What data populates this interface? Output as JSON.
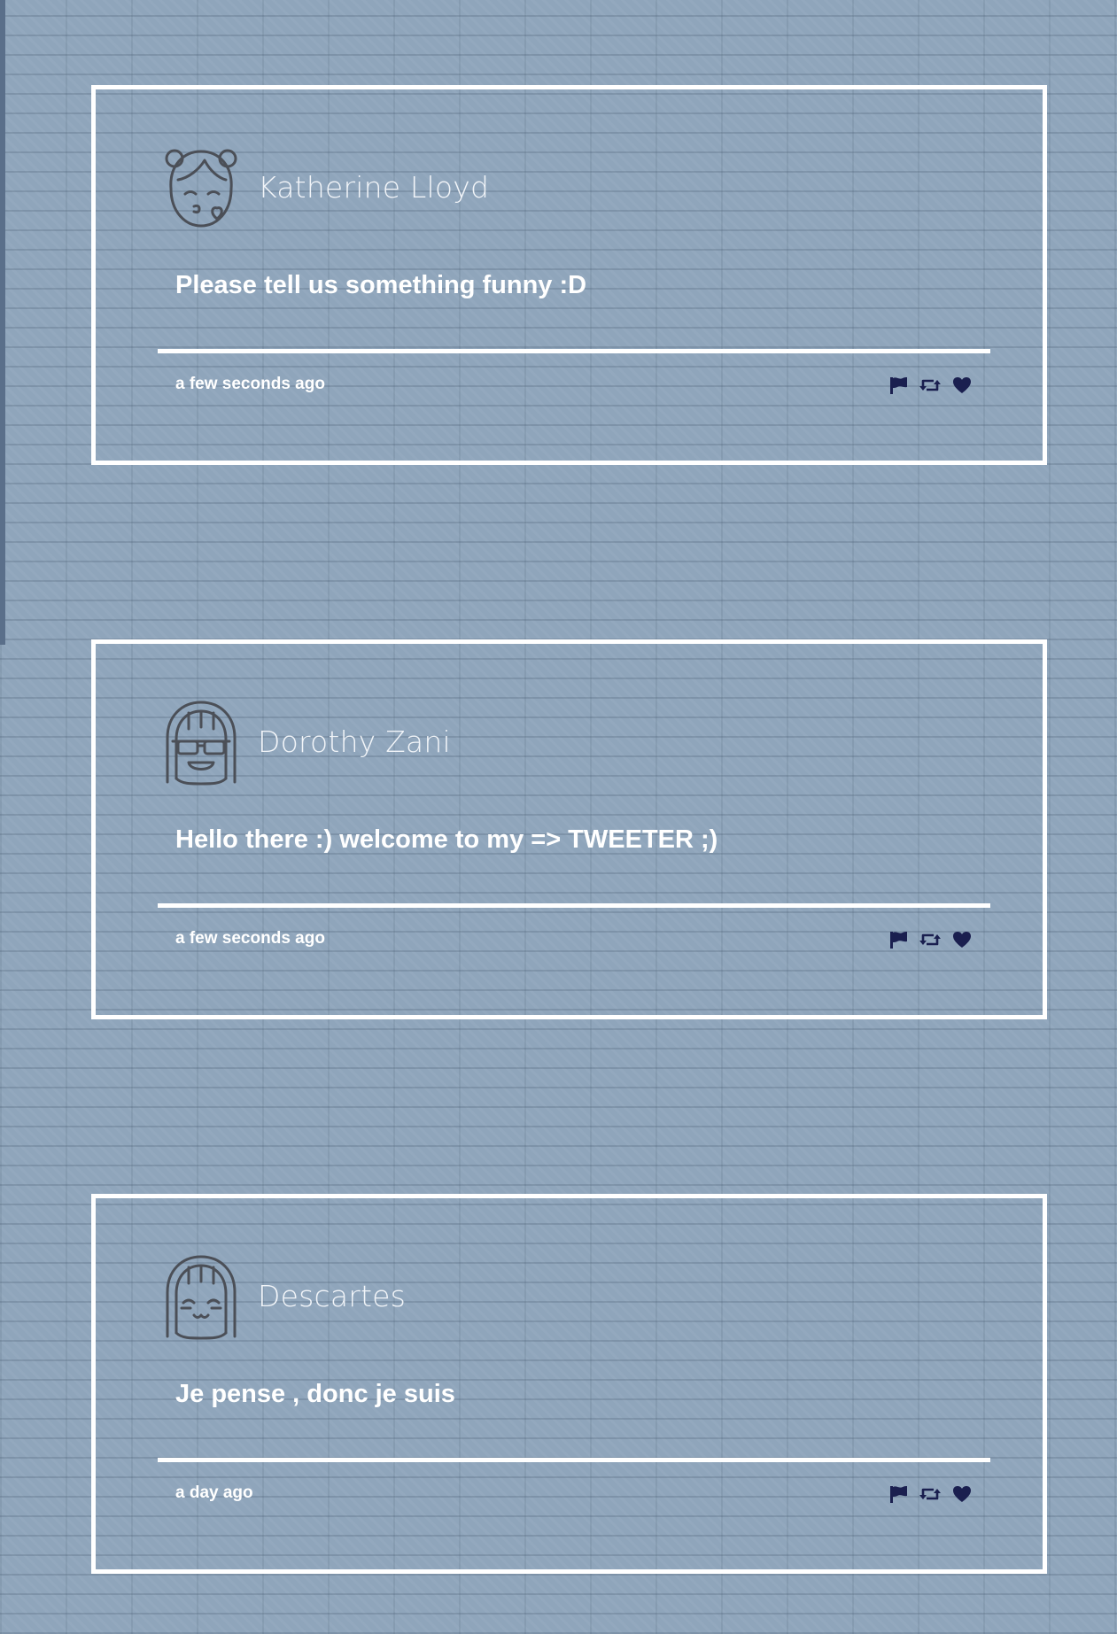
{
  "colors": {
    "background": "#8fa5bb",
    "card_border": "#ffffff",
    "text": "#ffffff",
    "icon": "#1a1f4f",
    "avatar_stroke": "#4b4f57"
  },
  "tweets": [
    {
      "author": "Katherine Lloyd",
      "avatar_icon": "kissing-girl-avatar-icon",
      "content": "Please tell us something funny :D",
      "timestamp": "a few seconds ago",
      "actions": [
        "flag-icon",
        "retweet-icon",
        "heart-icon"
      ]
    },
    {
      "author": "Dorothy Zani",
      "avatar_icon": "sunglasses-girl-avatar-icon",
      "content": "Hello there :) welcome to my => TWEETER ;)",
      "timestamp": "a few seconds ago",
      "actions": [
        "flag-icon",
        "retweet-icon",
        "heart-icon"
      ]
    },
    {
      "author": "Descartes",
      "avatar_icon": "happy-girl-avatar-icon",
      "content": "Je pense , donc je suis",
      "timestamp": "a day ago",
      "actions": [
        "flag-icon",
        "retweet-icon",
        "heart-icon"
      ]
    }
  ]
}
